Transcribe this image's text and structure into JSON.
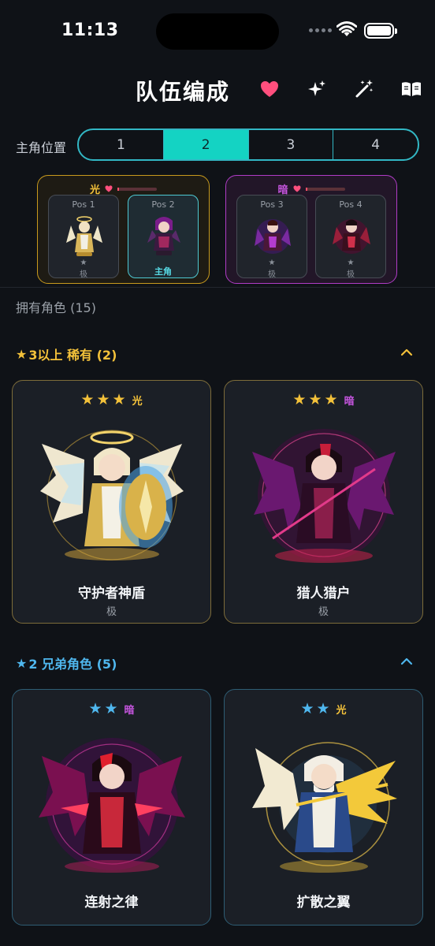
{
  "status_bar": {
    "time": "11:13"
  },
  "header": {
    "title": "队伍编成"
  },
  "lead_position": {
    "label": "主角位置",
    "options": [
      "1",
      "2",
      "3",
      "4"
    ],
    "selected": "2"
  },
  "team": {
    "groups": [
      {
        "element": "光",
        "slots": [
          {
            "pos": "Pos 1",
            "star": "★",
            "rank": "极",
            "is_lead": false
          },
          {
            "pos": "Pos 2",
            "lead_label": "主角",
            "is_lead": true
          }
        ]
      },
      {
        "element": "暗",
        "slots": [
          {
            "pos": "Pos 3",
            "star": "★",
            "rank": "极",
            "is_lead": false
          },
          {
            "pos": "Pos 4",
            "star": "★",
            "rank": "极",
            "is_lead": false
          }
        ]
      }
    ]
  },
  "owned": {
    "label": "拥有角色 (15)"
  },
  "sections": [
    {
      "star": "★",
      "title": "3以上 稀有 (2)",
      "color": "#f3c13a",
      "cards": [
        {
          "stars": 3,
          "element": "光",
          "name": "守护者神盾",
          "rank": "极"
        },
        {
          "stars": 3,
          "element": "暗",
          "name": "猎人猎户",
          "rank": "极"
        }
      ]
    },
    {
      "star": "★",
      "title": "2 兄弟角色 (5)",
      "color": "#4fb7ee",
      "cards": [
        {
          "stars": 2,
          "element": "暗",
          "name": "连射之律",
          "rank": ""
        },
        {
          "stars": 2,
          "element": "光",
          "name": "扩散之翼",
          "rank": ""
        }
      ]
    }
  ],
  "colors": {
    "accent_teal": "#14d3c3",
    "light_element": "#f3c13a",
    "dark_element": "#c756e0",
    "heart": "#ff4f6a"
  },
  "icons": [
    "heart-icon",
    "sparkles-icon",
    "magic-wand-icon",
    "book-icon",
    "chevron-up-icon"
  ]
}
